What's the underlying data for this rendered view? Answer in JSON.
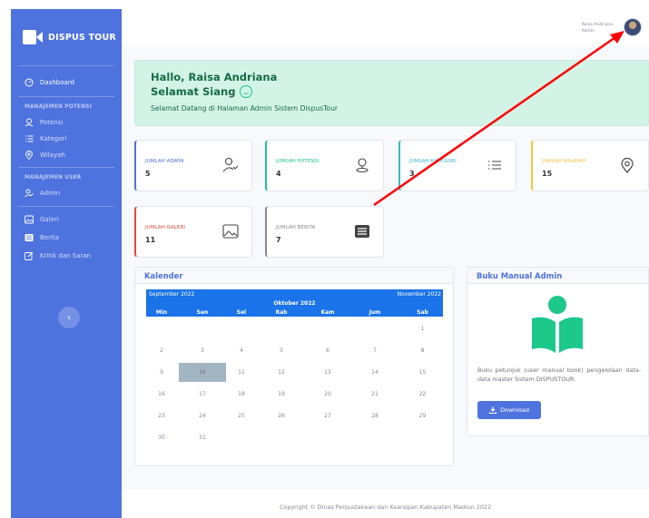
{
  "brand": {
    "name": "DISPUS TOUR"
  },
  "sidebar": {
    "dashboard": "Dashboard",
    "heading_potensi": "MANAJEMEN POTENSI",
    "potensi": "Potensi",
    "kategori": "Kategori",
    "wilayah": "Wilayah",
    "heading_user": "MANAJEMEN USER",
    "admin": "Admin",
    "galeri": "Galeri",
    "berita": "Berita",
    "kritik": "Kritik dan Saran",
    "toggle": "‹"
  },
  "topbar": {
    "user_name": "Raisa Andriana",
    "user_role": "Admin"
  },
  "welcome": {
    "greeting": "Hallo, Raisa Andriana",
    "time_greeting": "Selamat Siang",
    "message": "Selamat Datang di Halaman Admin Sistem DispusTour"
  },
  "stats": {
    "admin": {
      "label": "JUMLAH ADMIN",
      "value": "5",
      "color": "#4e73df"
    },
    "potensi": {
      "label": "JUMLAH POTENSI",
      "value": "4",
      "color": "#1cc88a"
    },
    "kategori": {
      "label": "JUMLAH KATEGORI",
      "value": "3",
      "color": "#36b9cc"
    },
    "wilayah": {
      "label": "JUMLAH WILAYAH",
      "value": "15",
      "color": "#f6c23e"
    },
    "galeri": {
      "label": "JUMLAH GALERI",
      "value": "11",
      "color": "#e74a3b"
    },
    "berita": {
      "label": "JUMLAH BERITA",
      "value": "7",
      "color": "#858796"
    }
  },
  "calendar": {
    "title": "Kalender",
    "prev_month": "September 2022",
    "current_month": "Oktober 2022",
    "next_month": "November 2022",
    "days": [
      "Min",
      "Sen",
      "Sel",
      "Rab",
      "Kam",
      "Jum",
      "Sab"
    ],
    "weeks": [
      [
        "",
        "",
        "",
        "",
        "",
        "",
        "1"
      ],
      [
        "2",
        "3",
        "4",
        "5",
        "6",
        "7",
        "8"
      ],
      [
        "9",
        "10",
        "11",
        "12",
        "13",
        "14",
        "15"
      ],
      [
        "16",
        "17",
        "18",
        "19",
        "20",
        "21",
        "22"
      ],
      [
        "23",
        "24",
        "25",
        "26",
        "27",
        "28",
        "29"
      ],
      [
        "30",
        "31",
        "",
        "",
        "",
        "",
        ""
      ]
    ],
    "selected": "10"
  },
  "manual": {
    "title": "Buku Manual Admin",
    "description": "Buku petunjuk (user manual book) pengelolaan data-data master Sistem DISPUSTOUR.",
    "download_label": "Download"
  },
  "footer": {
    "copyright": "Copyright © Dinas Perpustakaan dan Kearsipan Kabupaten Madiun 2022"
  },
  "annotation": {
    "arrow_color": "#ff0000"
  }
}
